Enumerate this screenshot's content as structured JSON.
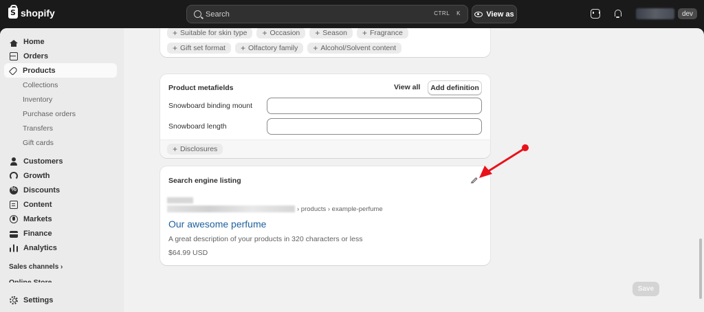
{
  "topbar": {
    "brand": "shopify",
    "search_placeholder": "Search",
    "shortcut_ctrl": "CTRL",
    "shortcut_key": "K",
    "view_as": "View as",
    "store_badge": "dev"
  },
  "sidebar": {
    "items": [
      {
        "label": "Home",
        "icon": "home-icon"
      },
      {
        "label": "Orders",
        "icon": "orders-icon"
      },
      {
        "label": "Products",
        "icon": "tag-icon",
        "active": true
      },
      {
        "label": "Customers",
        "icon": "customer-icon"
      },
      {
        "label": "Growth",
        "icon": "growth-icon"
      },
      {
        "label": "Discounts",
        "icon": "discount-icon"
      },
      {
        "label": "Content",
        "icon": "content-icon"
      },
      {
        "label": "Markets",
        "icon": "markets-icon"
      },
      {
        "label": "Finance",
        "icon": "finance-icon"
      },
      {
        "label": "Analytics",
        "icon": "analytics-icon"
      }
    ],
    "products_sub": [
      "Collections",
      "Inventory",
      "Purchase orders",
      "Transfers",
      "Gift cards"
    ],
    "sales_channels": "Sales channels ›",
    "online_store": "Online Store",
    "settings": "Settings"
  },
  "top_card": {
    "row1": [
      "Suitable for skin type",
      "Occasion",
      "Season",
      "Fragrance"
    ],
    "row2": [
      "Gift set format",
      "Olfactory family",
      "Alcohol/Solvent content"
    ]
  },
  "metafields": {
    "title": "Product metafields",
    "view_all": "View all",
    "add_definition": "Add definition",
    "fields": [
      {
        "label": "Snowboard binding mount",
        "value": ""
      },
      {
        "label": "Snowboard length",
        "value": ""
      }
    ],
    "pill": "Disclosures"
  },
  "seo": {
    "title": "Search engine listing",
    "url_path": "› products › example-perfume",
    "heading": "Our awesome perfume",
    "description": "A great description of your products in 320 characters or less",
    "price": "$64.99 USD"
  },
  "footer": {
    "save": "Save"
  },
  "colors": {
    "topbar_bg": "#1a1a1a",
    "link_blue": "#1d5f9e",
    "annotation_red": "#e8121b"
  }
}
